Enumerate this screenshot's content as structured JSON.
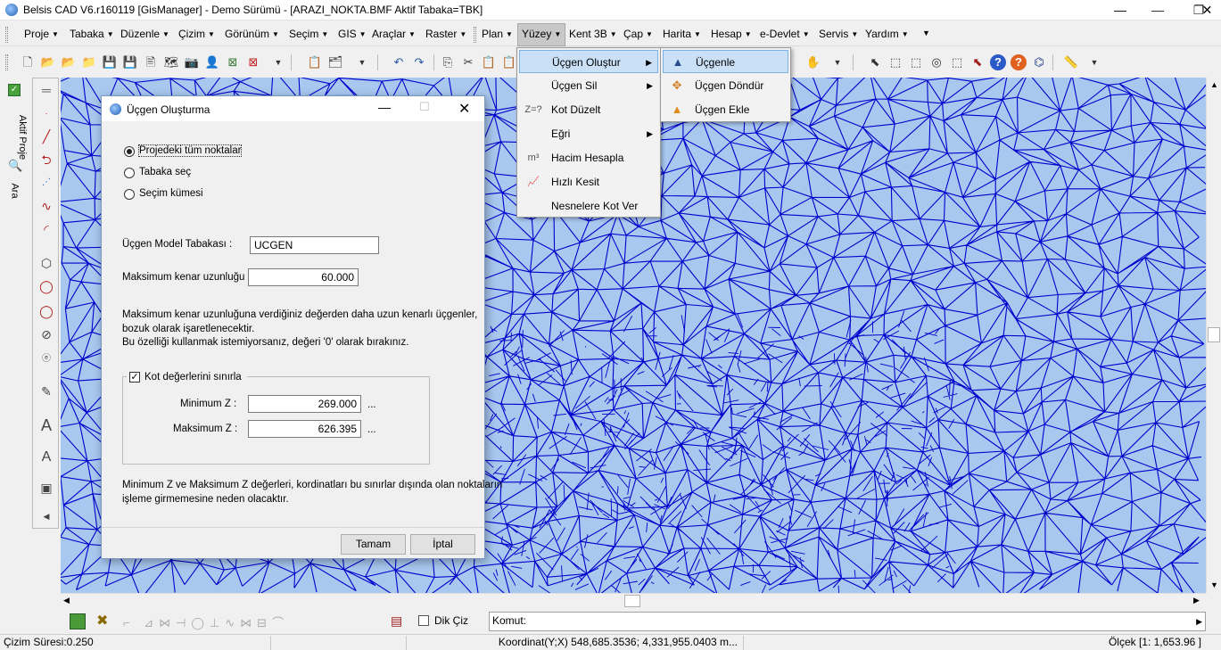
{
  "window": {
    "title": "Belsis CAD V6.r160119 [GisManager] - Demo Sürümü - [ARAZI_NOKTA.BMF  Aktif Tabaka=TBK]",
    "minimize": "—",
    "maximize": "❐",
    "close": "✕"
  },
  "menubar": {
    "items": [
      "Proje",
      "Tabaka",
      "Düzenle",
      "Çizim",
      "Görünüm",
      "Seçim",
      "GIS",
      "Araçlar",
      "Raster",
      "Plan",
      "Yüzey",
      "Kent 3B",
      "Çap",
      "Harita",
      "Hesap",
      "e-Devlet",
      "Servis",
      "Yardım"
    ],
    "active": "Yüzey"
  },
  "sidetabs": {
    "project": "Aktif Proje",
    "search": "Ara"
  },
  "yuzey_menu": {
    "items": [
      {
        "label": "Üçgen Oluştur",
        "icon": "",
        "submenu": true
      },
      {
        "label": "Üçgen Sil",
        "icon": "",
        "submenu": true
      },
      {
        "label": "Kot Düzelt",
        "icon": "Z=?",
        "submenu": false
      },
      {
        "label": "Eğri",
        "icon": "",
        "submenu": true
      },
      {
        "label": "Hacim Hesapla",
        "icon": "m³",
        "submenu": false
      },
      {
        "label": "Hızlı Kesit",
        "icon": "chart-icon",
        "submenu": false
      },
      {
        "label": "Nesnelere Kot Ver",
        "icon": "",
        "submenu": false
      }
    ]
  },
  "ucgen_submenu": {
    "items": [
      "Üçgenle",
      "Üçgen Döndür",
      "Üçgen Ekle"
    ]
  },
  "dialog": {
    "title": "Üçgen Oluşturma",
    "radio_all": "Projedeki tüm noktalar",
    "radio_layer": "Tabaka seç",
    "radio_selection": "Seçim kümesi",
    "layer_label": "Üçgen Model Tabakası :",
    "layer_value": "UCGEN",
    "max_edge_label": "Maksimum kenar uzunluğu :",
    "max_edge_value": "60.000",
    "info_line1": "Maksimum kenar uzunluğuna verdiğiniz değerden daha uzun kenarlı üçgenler,",
    "info_line2": "bozuk olarak işaretlenecektir.",
    "info_line3": "Bu özelliği kullanmak istemiyorsanız, değeri '0' olarak bırakınız.",
    "limit_check": "Kot değerlerini sınırla",
    "minz_label": "Minimum Z :",
    "minz_value": "269.000",
    "maxz_label": "Maksimum Z :",
    "maxz_value": "626.395",
    "dots": "...",
    "note_line1": "Minimum Z ve Maksimum Z değerleri, kordinatları bu sınırlar dışında olan noktaların",
    "note_line2": "işleme girmemesine neden olacaktır.",
    "ok": "Tamam",
    "cancel": "İptal"
  },
  "command": {
    "dik_ciz": "Dik Çiz",
    "prompt": "Komut:"
  },
  "status": {
    "draw_time": "Çizim Süresi:0.250",
    "coords": "Koordinat(Y;X)  548,685.3536; 4,331,955.0403 m...",
    "scale": "Ölçek [1: 1,653.96 ]"
  },
  "colors": {
    "canvas": "#a8c8f0",
    "mesh": "#0000cc",
    "highlight": "#c9e0f7"
  }
}
